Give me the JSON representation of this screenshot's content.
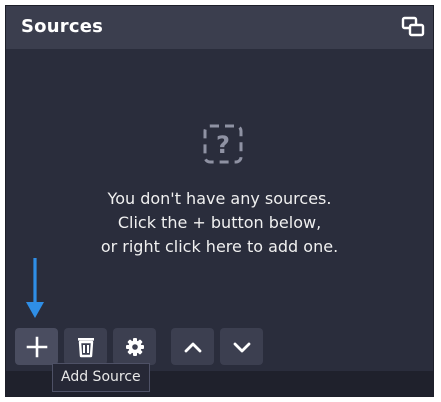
{
  "panel": {
    "title": "Sources",
    "undock_icon": "undock-icon"
  },
  "empty_state": {
    "icon": "question-mark-icon",
    "icon_glyph": "?",
    "line1": "You don't have any sources.",
    "line2": "Click the + button below,",
    "line3": "or right click here to add one."
  },
  "toolbar": {
    "buttons": [
      {
        "name": "add-source-button",
        "icon": "plus-icon"
      },
      {
        "name": "remove-source-button",
        "icon": "trash-icon"
      },
      {
        "name": "source-properties-button",
        "icon": "gear-icon"
      },
      {
        "name": "move-source-up-button",
        "icon": "chevron-up-icon"
      },
      {
        "name": "move-source-down-button",
        "icon": "chevron-down-icon"
      }
    ],
    "tooltip": "Add Source"
  },
  "annotation": {
    "icon": "arrow-down-icon",
    "color": "#2f8ee6"
  },
  "colors": {
    "panel_bg": "#2a2d3c",
    "header_bg": "#3b3e4e",
    "button_bg": "#3c3f50",
    "icon": "#ffffff",
    "muted_icon": "#8f92a3"
  }
}
